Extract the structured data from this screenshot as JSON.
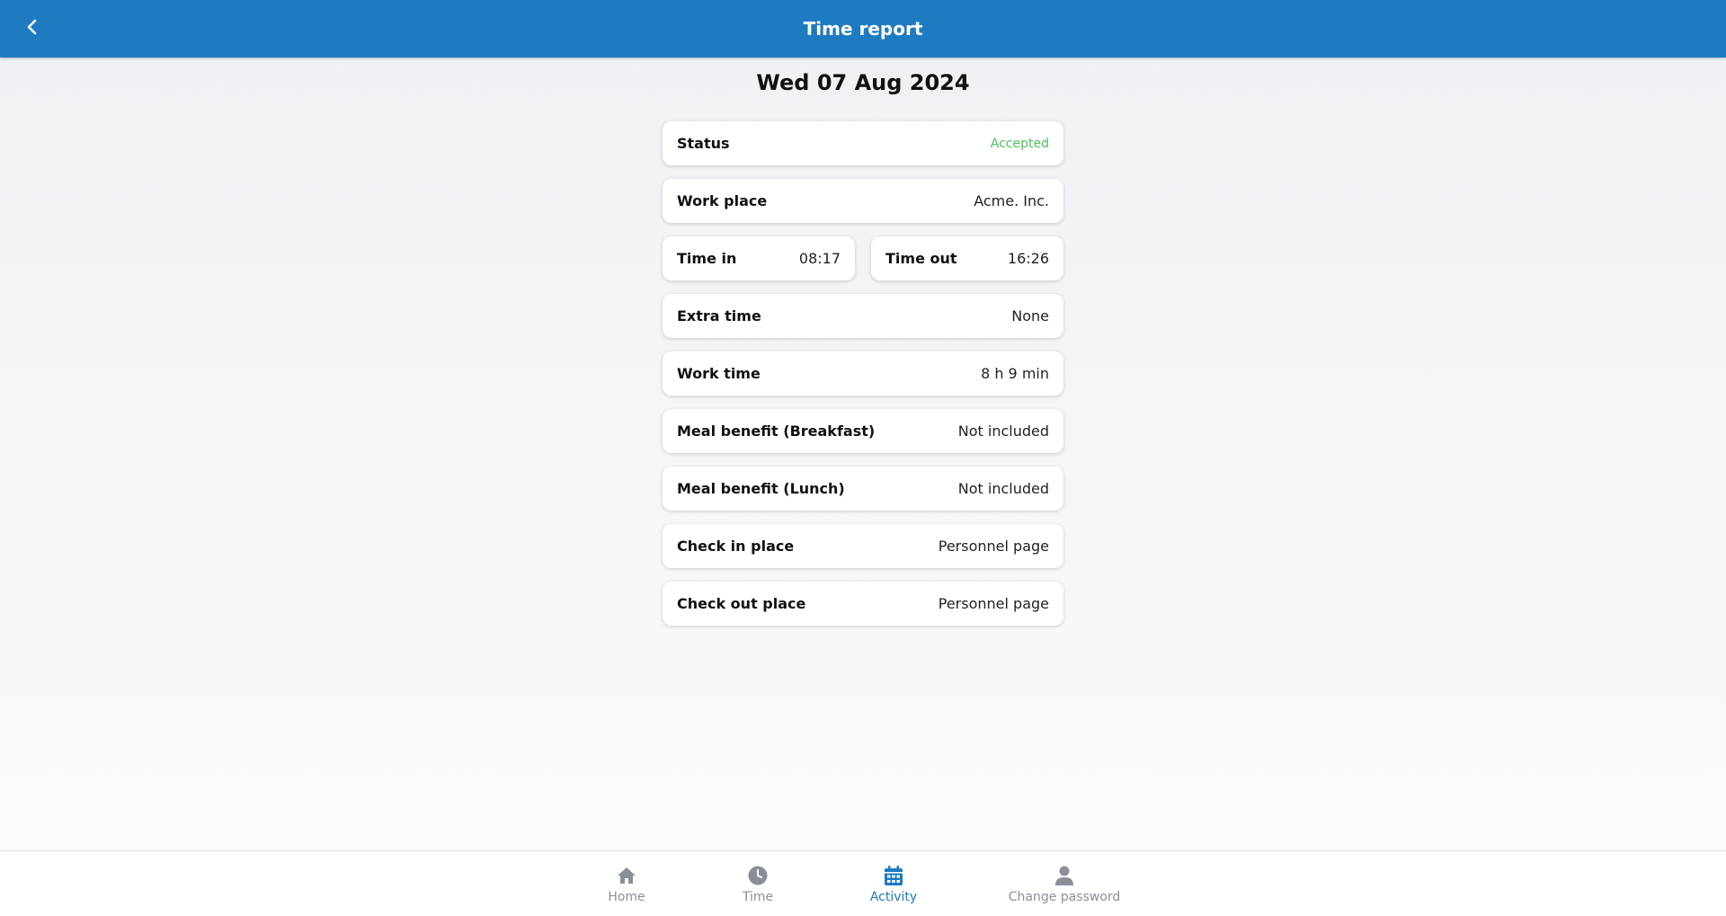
{
  "header": {
    "title": "Time report",
    "back_icon": "chevron-left-icon"
  },
  "report": {
    "date": "Wed 07 Aug 2024",
    "status": {
      "label": "Status",
      "value": "Accepted",
      "color": "#4cc25b"
    },
    "work_place": {
      "label": "Work place",
      "value": "Acme. Inc."
    },
    "time_in": {
      "label": "Time in",
      "value": "08:17"
    },
    "time_out": {
      "label": "Time out",
      "value": "16:26"
    },
    "extra_time": {
      "label": "Extra time",
      "value": "None"
    },
    "work_time": {
      "label": "Work time",
      "value": "8 h 9 min"
    },
    "meal_breakfast": {
      "label": "Meal benefit (Breakfast)",
      "value": "Not included"
    },
    "meal_lunch": {
      "label": "Meal benefit (Lunch)",
      "value": "Not included"
    },
    "check_in_place": {
      "label": "Check in place",
      "value": "Personnel page"
    },
    "check_out_place": {
      "label": "Check out place",
      "value": "Personnel page"
    }
  },
  "nav": {
    "items": [
      {
        "label": "Home",
        "icon": "home-icon",
        "active": false
      },
      {
        "label": "Time",
        "icon": "clock-icon",
        "active": false
      },
      {
        "label": "Activity",
        "icon": "calendar-icon",
        "active": true
      },
      {
        "label": "Change password",
        "icon": "user-icon",
        "active": false
      }
    ]
  },
  "colors": {
    "accent": "#1e7bc2",
    "inactive_nav": "#8a8f97",
    "accepted": "#4cc25b"
  }
}
